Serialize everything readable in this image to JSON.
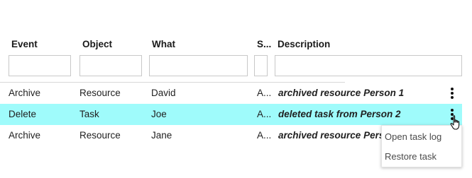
{
  "columns": {
    "event": {
      "label": "Event",
      "filter_value": ""
    },
    "object": {
      "label": "Object",
      "filter_value": ""
    },
    "what": {
      "label": "What",
      "filter_value": ""
    },
    "status": {
      "label": "S...",
      "filter_value": ""
    },
    "description": {
      "label": "Description",
      "filter_value": ""
    }
  },
  "rows": [
    {
      "event": "Archive",
      "object": "Resource",
      "what": "David",
      "status": "A...",
      "description": "archived resource Person 1",
      "selected": false
    },
    {
      "event": "Delete",
      "object": "Task",
      "what": "Joe",
      "status": "A...",
      "description": "deleted task from Person 2",
      "selected": true
    },
    {
      "event": "Archive",
      "object": "Resource",
      "what": "Jane",
      "status": "A...",
      "description": "archived resource Person",
      "selected": false
    }
  ],
  "context_menu": {
    "items": [
      {
        "label": "Open task log"
      },
      {
        "label": "Restore task"
      }
    ]
  },
  "icons": {
    "row_actions": "kebab-menu-icon",
    "pointer": "hand-pointer-cursor-icon"
  },
  "colors": {
    "selected_row": "#9ffbfb",
    "menu_text": "#4a4a4a"
  }
}
